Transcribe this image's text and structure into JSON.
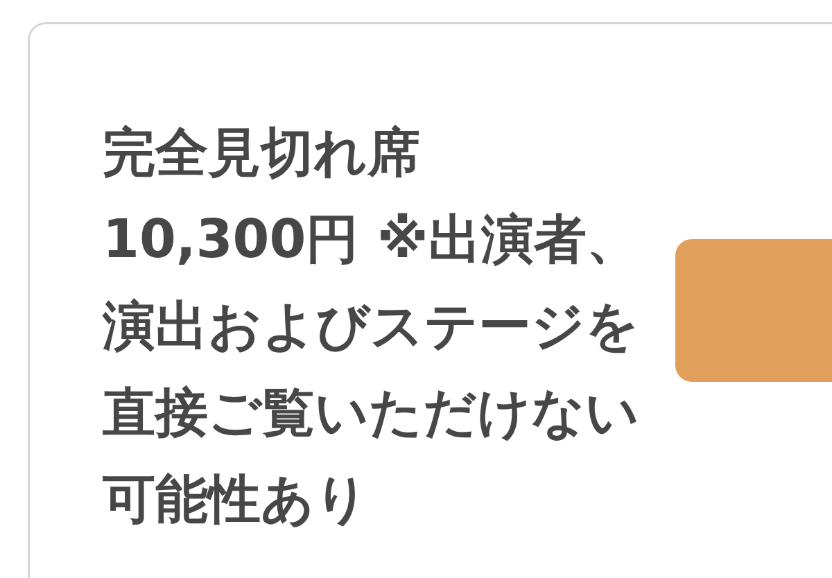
{
  "card": {
    "title": "完全見切れ席",
    "description": "10,300円 ※出演者、演出およびステージを直接ご覧いただけない可能性あり"
  }
}
